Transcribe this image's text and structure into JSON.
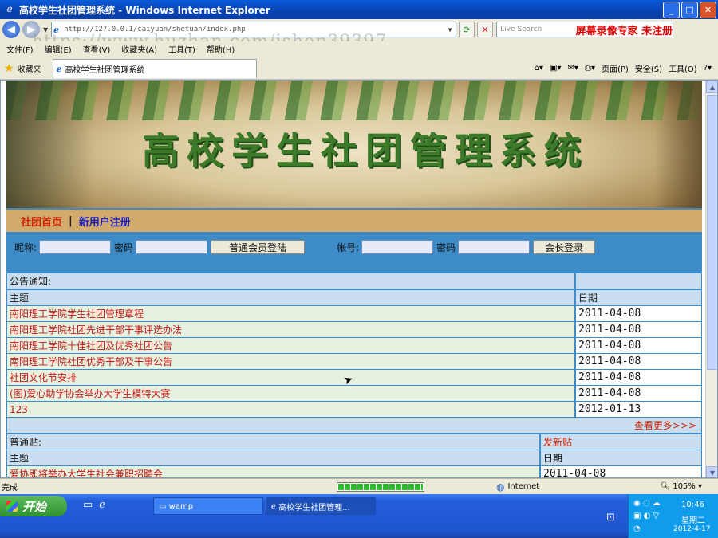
{
  "window": {
    "title": "高校学生社团管理系统 - Windows Internet Explorer",
    "min": "_",
    "max": "□",
    "close": "✕"
  },
  "address": {
    "url": "http://127.0.0.1/caiyuan/shetuan/index.php"
  },
  "search": {
    "placeholder": "Live Search",
    "overlay": "屏幕录像专家 未注册"
  },
  "watermark": "https://www.huzhan.com/ishop39397",
  "menu": [
    "文件(F)",
    "编辑(E)",
    "查看(V)",
    "收藏夹(A)",
    "工具(T)",
    "帮助(H)"
  ],
  "favorites": {
    "label": "收藏夹",
    "tab": "高校学生社团管理系统"
  },
  "tools": {
    "page": "页面(P)",
    "safety": "安全(S)",
    "tools": "工具(O)"
  },
  "banner": {
    "title": "高校学生社团管理系统"
  },
  "nav": {
    "home": "社团首页",
    "sep": "|",
    "register": "新用户注册"
  },
  "login": {
    "nick_label": "昵称:",
    "pwd_label": "密码",
    "member_btn": "普通会员登陆",
    "acct_label": "帐号:",
    "pwd2_label": "密码",
    "leader_btn": "会长登录"
  },
  "notices": {
    "section": "公告通知:",
    "col_subject": "主题",
    "col_date": "日期",
    "rows": [
      {
        "subject": "南阳理工学院学生社团管理章程",
        "date": "2011-04-08"
      },
      {
        "subject": "南阳理工学院社团先进干部干事评选办法",
        "date": "2011-04-08"
      },
      {
        "subject": "南阳理工学院十佳社团及优秀社团公告",
        "date": "2011-04-08"
      },
      {
        "subject": "南阳理工学院社团优秀干部及干事公告",
        "date": "2011-04-08"
      },
      {
        "subject": "社团文化节安排",
        "date": "2011-04-08"
      },
      {
        "subject": "(图)爱心助学协会举办大学生模特大赛",
        "date": "2011-04-08"
      },
      {
        "subject": "123",
        "date": "2012-01-13"
      }
    ],
    "more": "查看更多>>>"
  },
  "posts": {
    "section": "普通贴:",
    "new_post": "发新贴",
    "col_subject": "主题",
    "col_date": "日期",
    "rows": [
      {
        "subject": "爱协即将举办大学生社会兼职招聘会",
        "date": "2011-04-08"
      }
    ]
  },
  "status": {
    "text": "完成",
    "zone": "Internet",
    "zoom": "105%",
    "progress_fraction": 1.0
  },
  "taskbar": {
    "start": "开始",
    "items": [
      "wamp",
      "高校学生社团管理..."
    ],
    "clock": {
      "time": "10:46",
      "day": "星期二",
      "date": "2012-4-17"
    }
  }
}
